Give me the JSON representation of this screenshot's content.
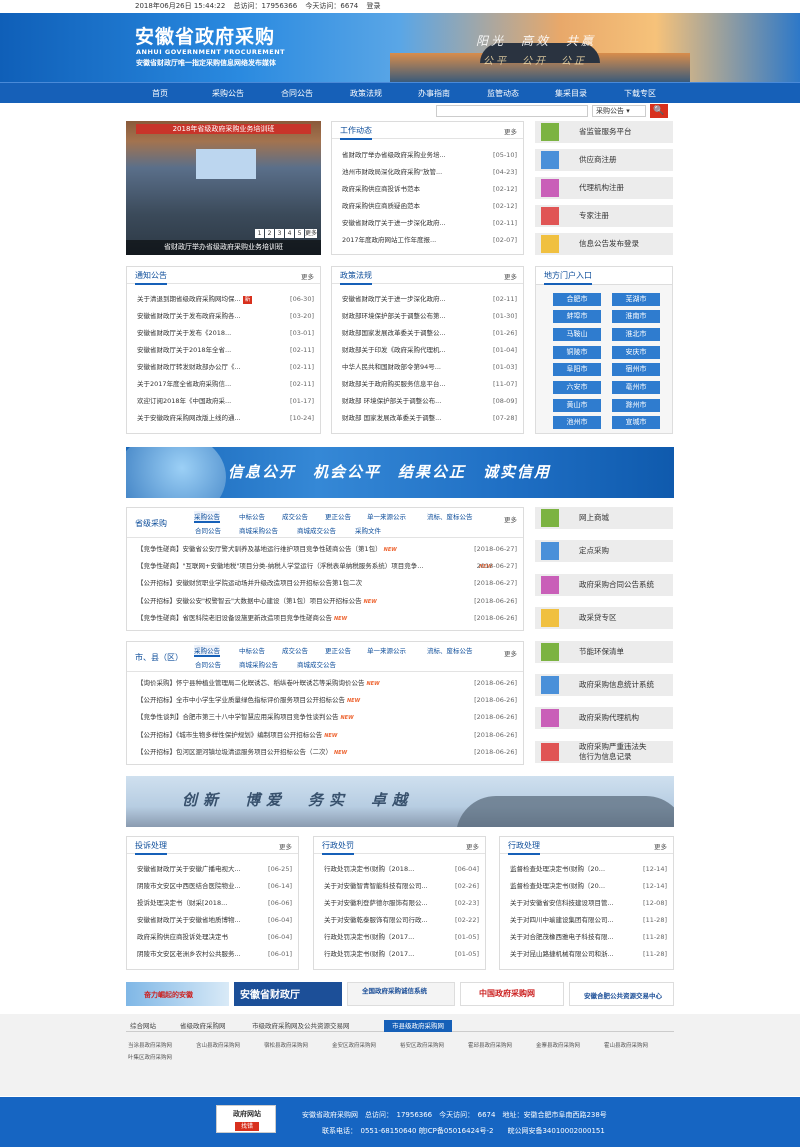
{
  "topbar": {
    "date": "2018年06月26日 15:44:22",
    "total_label": "总访问：",
    "total": "17956366",
    "today_label": "今天访问：",
    "today": "6674",
    "login": "登录"
  },
  "header": {
    "title": "安徽省政府采购",
    "title_en": "ANHUI GOVERNMENT PROCUREMENT",
    "subtitle": "安徽省财政厅唯一指定采购信息网络发布媒体",
    "slogan1": "阳光　高效　共赢",
    "slogan2": "公平　公开　公正"
  },
  "nav": [
    "首页",
    "采购公告",
    "合同公告",
    "政策法规",
    "办事指南",
    "监管动态",
    "集采目录",
    "下载专区"
  ],
  "search": {
    "placeholder": "",
    "select": "采购公告 ▾",
    "button": "🔍"
  },
  "photo": {
    "banner": "2018年省级政府采购业务培训班",
    "caption": "省财政厅举办省级政府采购业务培训班",
    "pager": [
      "1",
      "2",
      "3",
      "4",
      "5",
      "更多"
    ]
  },
  "work": {
    "title": "工作动态",
    "more": "更多",
    "items": [
      {
        "t": "省财政厅举办省级政府采购业务培...",
        "d": "[05-10]"
      },
      {
        "t": "池州市财政局深化政府采购\"放管...",
        "d": "[04-23]"
      },
      {
        "t": "政府采购供应商投诉书范本",
        "d": "[02-12]"
      },
      {
        "t": "政府采购供应商质疑函范本",
        "d": "[02-12]"
      },
      {
        "t": "安徽省财政厅关于进一步深化政府...",
        "d": "[02-11]"
      },
      {
        "t": "2017年度政府网站工作年度报...",
        "d": "[02-07]"
      }
    ]
  },
  "services": [
    "省监管服务平台",
    "供应商注册",
    "代理机构注册",
    "专家注册",
    "信息公告发布登录"
  ],
  "notice": {
    "title": "通知公告",
    "more": "更多",
    "items": [
      {
        "t": "关于清退到期省级政府采购网均保...",
        "d": "[06-30]",
        "new": "新"
      },
      {
        "t": "安徽省财政厅关于发布政府采购各...",
        "d": "[03-20]"
      },
      {
        "t": "安徽省财政厅关于发布《2018...",
        "d": "[03-01]"
      },
      {
        "t": "安徽省财政厅关于2018年全省...",
        "d": "[02-11]"
      },
      {
        "t": "安徽省财政厅转发财政部办公厅《...",
        "d": "[02-11]"
      },
      {
        "t": "关于2017年度全省政府采购信...",
        "d": "[02-11]"
      },
      {
        "t": "欢迎订阅2018年《中国政府采...",
        "d": "[01-17]"
      },
      {
        "t": "关于安徽政府采购网改版上线的通...",
        "d": "[10-24]"
      }
    ]
  },
  "policy": {
    "title": "政策法规",
    "more": "更多",
    "items": [
      {
        "t": "安徽省财政厅关于进一步深化政府...",
        "d": "[02-11]"
      },
      {
        "t": "财政部环境保护部关于调整公布第...",
        "d": "[01-30]"
      },
      {
        "t": "财政部国家发展改革委关于调整公...",
        "d": "[01-26]"
      },
      {
        "t": "财政部关于印发《政府采购代理机...",
        "d": "[01-04]"
      },
      {
        "t": "中华人民共和国财政部令第94号...",
        "d": "[01-03]"
      },
      {
        "t": "财政部关于政府购买服务信息平台...",
        "d": "[11-07]"
      },
      {
        "t": "财政部 环境保护部关于调整公布...",
        "d": "[08-09]"
      },
      {
        "t": "财政部 国家发展改革委关于调整...",
        "d": "[07-28]"
      }
    ]
  },
  "regions": {
    "title": "地方门户入口",
    "items": [
      "合肥市",
      "芜湖市",
      "蚌埠市",
      "淮南市",
      "马鞍山",
      "淮北市",
      "铜陵市",
      "安庆市",
      "阜阳市",
      "宿州市",
      "六安市",
      "亳州市",
      "黄山市",
      "滁州市",
      "池州市",
      "宣城市"
    ]
  },
  "banner2": {
    "text": "信息公开　机会公平　结果公正　诚实信用"
  },
  "provincial": {
    "title": "省级采购",
    "more": "更多",
    "tabs": [
      "采购公告",
      "中标公告",
      "成交公告",
      "更正公告",
      "单一来源公示",
      "流标、废标公告",
      "合同公告",
      "商城采购公告",
      "商城成交公告",
      "采购文件"
    ],
    "items": [
      {
        "t": "【竞争性磋商】安徽省公安厅警犬驯养及基地运行维护项目竞争性磋商公告（第1包）",
        "d": "[2018-06-27]"
      },
      {
        "t": "【竞争性磋商】\"互联网+安徽地税\"项目分类-纳税人学堂运行（浮税表单纳税服务系统）项目竞争...",
        "d": "[2018-06-27]"
      },
      {
        "t": "【公开招标】安徽财贸职业学院运动场并升级改造项目公开招标公告第1包二次",
        "d": "[2018-06-27]"
      },
      {
        "t": "【公开招标】安徽公安\"权警智云\"大数据中心建设（第1包）项目公开招标公告",
        "d": "[2018-06-26]"
      },
      {
        "t": "【竞争性磋商】省医科院老旧设备设施更新改造项目竞争性磋商公告",
        "d": "[2018-06-26]"
      }
    ]
  },
  "city": {
    "title": "市、县（区）",
    "more": "更多",
    "tabs": [
      "采购公告",
      "中标公告",
      "成交公告",
      "更正公告",
      "单一来源公示",
      "流标、废标公告",
      "合同公告",
      "商城采购公告",
      "商城成交公告"
    ],
    "items": [
      {
        "t": "【询价采购】怀宁县种植业管理局二化螟诱芯、稻纵卷叶螟诱芯等采购询价公告",
        "d": "[2018-06-26]"
      },
      {
        "t": "【公开招标】全市中小学生学业质量绿色指标评价服务项目公开招标公告",
        "d": "[2018-06-26]"
      },
      {
        "t": "【竞争性谈判】合肥市第三十八中学智慧应用采购项目竞争性谈判公告",
        "d": "[2018-06-26]"
      },
      {
        "t": "【公开招标】《城市生物多样性保护规划》编制项目公开招标公告",
        "d": "[2018-06-26]"
      },
      {
        "t": "【公开招标】包河区淝河镇垃圾清运服务项目公开招标公告（二次）",
        "d": "[2018-06-26]"
      }
    ]
  },
  "services2": [
    "网上商城",
    "定点采购",
    "政府采购合同公告系统",
    "政采贷专区",
    "节能环保清单",
    "政府采购信息统计系统",
    "政府采购代理机构",
    "政府采购严重违法失信行为信息记录"
  ],
  "banner3": {
    "text": "创新　博爱　务实　卓越"
  },
  "complaint": {
    "title": "投诉处理",
    "more": "更多",
    "items": [
      {
        "t": "安徽省财政厅关于安徽广播电视大...",
        "d": "[06-25]"
      },
      {
        "t": "阴陵市文安区中西医结合医院物业...",
        "d": "[06-14]"
      },
      {
        "t": "投诉处理决定书（财采[2018...",
        "d": "[06-06]"
      },
      {
        "t": "安徽省财政厅关于安徽省地质博物...",
        "d": "[06-04]"
      },
      {
        "t": "政府采购供应商投诉处理决定书",
        "d": "[06-04]"
      },
      {
        "t": "阴陵市文安区老洲乡农村公共服务...",
        "d": "[06-01]"
      }
    ]
  },
  "penalty": {
    "title": "行政处罚",
    "more": "更多",
    "items": [
      {
        "t": "行政处罚决定书(财购〔2018...",
        "d": "[06-04]"
      },
      {
        "t": "关于对安徽智青智能科技有限公司...",
        "d": "[02-26]"
      },
      {
        "t": "关于对安徽利登萨德尔服饰有限公...",
        "d": "[02-23]"
      },
      {
        "t": "关于对安徽乾泰服饰有限公司行政...",
        "d": "[02-22]"
      },
      {
        "t": "行政处罚决定书(财购〔2017...",
        "d": "[01-05]"
      },
      {
        "t": "行政处罚决定书(财购〔2017...",
        "d": "[01-05]"
      }
    ]
  },
  "admin": {
    "title": "行政处理",
    "more": "更多",
    "items": [
      {
        "t": "监督检查处理决定书(财购〔20...",
        "d": "[12-14]"
      },
      {
        "t": "监督检查处理决定书(财购〔20...",
        "d": "[12-14]"
      },
      {
        "t": "关于对安徽省安信科技建设项目管...",
        "d": "[12-08]"
      },
      {
        "t": "关于对四川中瑜建设集团有限公司...",
        "d": "[11-28]"
      },
      {
        "t": "关于对合肥茂橡西雅电子科技有限...",
        "d": "[11-28]"
      },
      {
        "t": "关于对昆山路捷机械有限公司和浙...",
        "d": "[11-28]"
      }
    ]
  },
  "friendlinks": [
    "奋力崛起的安徽",
    "安徽省财政厅",
    "全国政府采购诚信系统",
    "中国政府采购网",
    "安徽合肥公共资源交易中心"
  ],
  "linktabs": [
    "综合网站",
    "省级政府采购网",
    "市级政府采购网及公共资源交易网",
    "市县级政府采购网"
  ],
  "counties": [
    "当涂县政府采购网",
    "含山县政府采购网",
    "宿松县政府采购网",
    "金安区政府采购网",
    "裕安区政府采购网",
    "霍邱县政府采购网",
    "金寨县政府采购网",
    "霍山县政府采购网",
    "叶集区政府采购网"
  ],
  "footer": {
    "badge_top": "政府网站",
    "badge_bottom": "找错",
    "line1": "安徽省政府采购网　总访问：　17956366　今天访问：　6674　地址：安徽合肥市阜南西路238号",
    "line2": "联系电话：　0551-68150640 皖ICP备05016424号-2　　皖公网安备34010002000151"
  }
}
